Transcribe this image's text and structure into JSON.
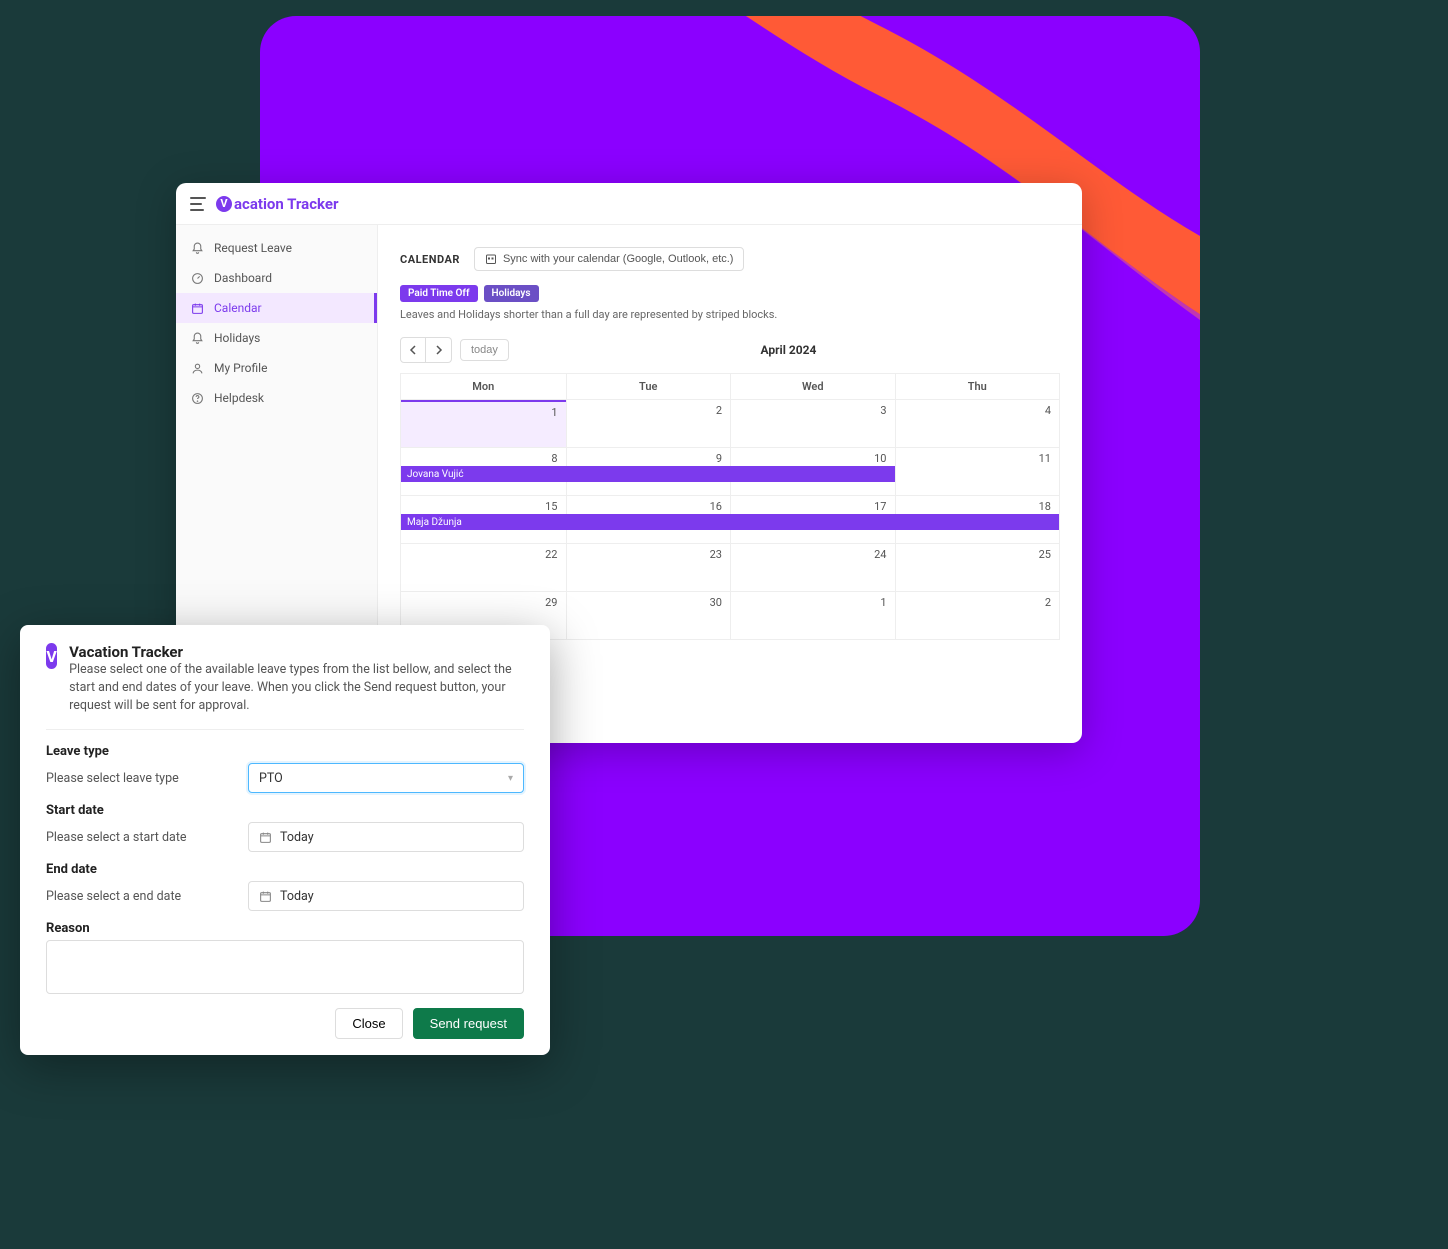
{
  "app": {
    "brand": "acation Tracker"
  },
  "sidebar": {
    "items": [
      {
        "label": "Request Leave"
      },
      {
        "label": "Dashboard"
      },
      {
        "label": "Calendar"
      },
      {
        "label": "Holidays"
      },
      {
        "label": "My Profile"
      },
      {
        "label": "Helpdesk"
      }
    ]
  },
  "main": {
    "title": "CALENDAR",
    "sync_label": "Sync with your calendar (Google, Outlook, etc.)",
    "pill_pto": "Paid Time Off",
    "pill_holidays": "Holidays",
    "subnote": "Leaves and Holidays shorter than a full day are represented by striped blocks.",
    "today_label": "today",
    "month_label": "April 2024",
    "day_heads": [
      "Mon",
      "Tue",
      "Wed",
      "Thu"
    ],
    "rows": [
      {
        "dates": [
          "1",
          "2",
          "3",
          "4"
        ],
        "highlight": 0
      },
      {
        "dates": [
          "8",
          "9",
          "10",
          "11"
        ],
        "event": {
          "name": "Jovana Vujić",
          "span": 3
        }
      },
      {
        "dates": [
          "15",
          "16",
          "17",
          "18"
        ],
        "event": {
          "name": "Maja Džunja",
          "span": 4
        }
      },
      {
        "dates": [
          "22",
          "23",
          "24",
          "25"
        ]
      },
      {
        "dates": [
          "29",
          "30",
          "1",
          "2"
        ]
      }
    ]
  },
  "modal": {
    "title": "Vacation Tracker",
    "desc": "Please select one of the available leave types from the list bellow, and select the start and end dates of your leave. When you click the Send request button, your request will be sent for approval.",
    "leave_type_label": "Leave type",
    "leave_type_sub": "Please select leave type",
    "leave_type_value": "PTO",
    "start_label": "Start date",
    "start_sub": "Please select a start date",
    "start_value": "Today",
    "end_label": "End date",
    "end_sub": "Please select a end date",
    "end_value": "Today",
    "reason_label": "Reason",
    "close_label": "Close",
    "send_label": "Send request"
  }
}
